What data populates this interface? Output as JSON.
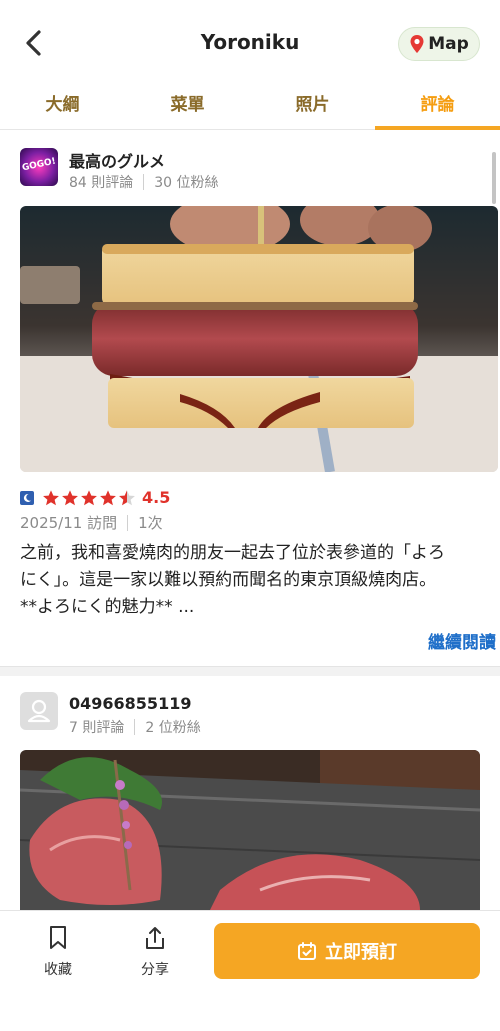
{
  "header": {
    "title": "Yoroniku",
    "map_label": "Map"
  },
  "tabs": [
    {
      "label": "大綱",
      "active": false
    },
    {
      "label": "菜單",
      "active": false
    },
    {
      "label": "照片",
      "active": false
    },
    {
      "label": "評論",
      "active": true
    }
  ],
  "reviews": [
    {
      "user_name": "最高のグルメ",
      "avatar_text": "GOGO!",
      "review_count": "84 則評論",
      "followers": "30 位粉絲",
      "rating": "4.5",
      "stars": 4.5,
      "visit_date": "2025/11 訪問",
      "visit_count": "1次",
      "text_lines": [
        "之前，我和喜愛燒肉的朋友一起去了位於表參道的「よろ",
        "にく」。這是一家以難以預約而聞名的東京頂級燒肉店。",
        "**よろにく的魅力**  ..."
      ],
      "read_more": "繼續閱讀"
    },
    {
      "user_name": "04966855119",
      "review_count": "7 則評論",
      "followers": "2 位粉絲"
    }
  ],
  "bottom_bar": {
    "bookmark_label": "收藏",
    "share_label": "分享",
    "reserve_label": "立即預訂"
  },
  "colors": {
    "accent": "#f5a623",
    "tab_text": "#8a6b2a",
    "rating_red": "#e0322b",
    "link_blue": "#1f6fc9"
  }
}
